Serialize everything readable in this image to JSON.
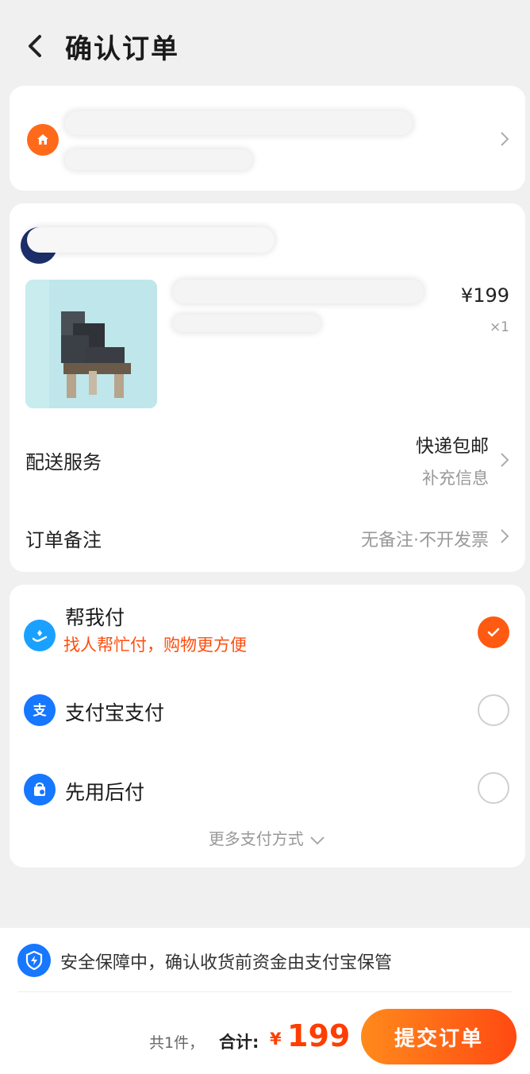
{
  "header": {
    "title": "确认订单"
  },
  "product": {
    "price": "¥199",
    "qty": "×1"
  },
  "delivery": {
    "label": "配送服务",
    "value": "快递包邮",
    "sub": "补充信息"
  },
  "note": {
    "label": "订单备注",
    "value": "无备注·不开发票"
  },
  "payment": {
    "options": [
      {
        "title": "帮我付",
        "subtitle": "找人帮忙付，购物更方便",
        "selected": true,
        "icon": "help-pay-icon"
      },
      {
        "title": "支付宝支付",
        "selected": false,
        "icon": "alipay-icon"
      },
      {
        "title": "先用后付",
        "selected": false,
        "icon": "pay-later-icon"
      }
    ],
    "more": "更多支付方式"
  },
  "footer": {
    "safety": "安全保障中，确认收货前资金由支付宝保管",
    "count": "共1件，",
    "total_label": "合计:",
    "currency": "¥",
    "total": "199",
    "submit": "提交订单"
  },
  "colors": {
    "accent": "#ff4a12",
    "alipay_blue": "#1677ff",
    "home_orange": "#ff6a1a"
  }
}
